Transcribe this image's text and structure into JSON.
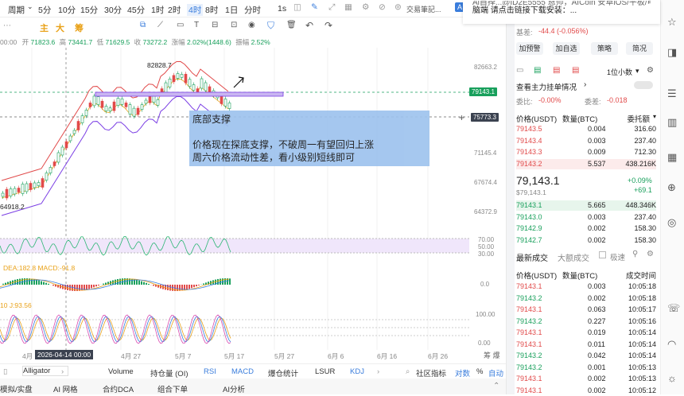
{
  "toolbar": {
    "period_label": "周期",
    "intervals": [
      "5分",
      "10分",
      "15分",
      "30分",
      "45分",
      "1时",
      "2时",
      "4时",
      "8时",
      "1日",
      "分时"
    ],
    "active_interval": "4时",
    "extra": "1s",
    "note_button": "交易筆記...",
    "ai_label": "A"
  },
  "toolbar2": {
    "items": [
      "主",
      "大",
      "筹"
    ]
  },
  "ohlc": {
    "time": "00:00",
    "open_label": "开",
    "open": "71823.6",
    "high_label": "高",
    "high": "73441.7",
    "low_label": "低",
    "low": "71629.5",
    "close_label": "收",
    "close": "73272.2",
    "change_label": "涨幅",
    "change": "2.02%(1448.6)",
    "amp_label": "振幅",
    "amp": "2.52%"
  },
  "chart": {
    "price_labels": [
      "82663.2",
      "79143.1",
      "75773.3",
      "71145.4",
      "67674.4",
      "64372.9"
    ],
    "high_marker": "82828.7",
    "low_marker": "64918.2",
    "rsi_labels": [
      "70.00",
      "50.00",
      "30.00"
    ],
    "macd_labels": [
      "0.0"
    ],
    "kdj_labels": [
      "100.00",
      "0.00"
    ],
    "macd_text": "DEA:182.8  MACD:-91.8",
    "kdj_text": "10  J:93.56",
    "dates": [
      "4月",
      "4月 27",
      "5月 7",
      "5月 17",
      "5月 27",
      "6月 6",
      "6月 16",
      "6月 26"
    ],
    "cursor_date": "2026-04-14 00:00",
    "side_chars": "筹 爆",
    "colors": {
      "up": "#19a05c",
      "down": "#e14a4a",
      "accent": "#3a7ddc",
      "annot_bg": "#9ec3ee"
    }
  },
  "annotation": {
    "title": "底部支撑",
    "line1": "价格现在探底支撑，不破周一有望回归上涨",
    "line2": "周六价格流动性差，看小级别短线即可"
  },
  "bottom_tabs": {
    "left": "Alligator",
    "items": [
      "Volume",
      "持仓量 (OI)",
      "RSI",
      "MACD",
      "爆仓统计",
      "LSUR",
      "KDJ"
    ],
    "community": "社区指标",
    "log": "对数",
    "pct": "%",
    "auto": "自动"
  },
  "footer": {
    "items": [
      "模拟/实盘",
      "AI 网格",
      "合约DCA",
      "组合下单",
      "AI分析"
    ]
  },
  "notice": {
    "line1": "Al自择...@ID2E5555 恩师，AICoin 安卓iOS/平板/电",
    "line2": "脑端 请点击链接下载安装：..."
  },
  "right": {
    "basis_label": "基差:",
    "basis": "-44.4 (-0.056%)",
    "buttons": [
      "加预警",
      "加自选",
      "策略",
      "简况"
    ],
    "depth_select": "1位小数",
    "big_orders": "查看主力挂单情况",
    "wei_bi_label": "委比:",
    "wei_bi": "-0.00%",
    "wei_cha_label": "委差:",
    "wei_cha": "-0.018",
    "ob_header": [
      "价格(USDT)",
      "数量(BTC)",
      "委托额"
    ],
    "asks": [
      [
        "79143.5",
        "0.004",
        "316.60"
      ],
      [
        "79143.4",
        "0.003",
        "237.40"
      ],
      [
        "79143.3",
        "0.009",
        "712.30"
      ],
      [
        "79143.2",
        "5.537",
        "438.216K"
      ]
    ],
    "last_price": "79,143.1",
    "last_price_sub": "$79,143.1",
    "change_pct": "+0.09%",
    "change_abs": "+69.1",
    "bids": [
      [
        "79143.1",
        "5.665",
        "448.346K"
      ],
      [
        "79143.0",
        "0.003",
        "237.40"
      ],
      [
        "79142.9",
        "0.002",
        "158.30"
      ],
      [
        "79142.7",
        "0.002",
        "158.30"
      ]
    ],
    "trades_tab": "最新成交",
    "big_trades_tab": "大额成交",
    "extreme": "极速",
    "trades_header": [
      "价格(USDT)",
      "数量(BTC)",
      "成交时间"
    ],
    "trades": [
      [
        "79143.1",
        "0.003",
        "10:05:18",
        "down"
      ],
      [
        "79143.2",
        "0.002",
        "10:05:18",
        "up"
      ],
      [
        "79143.1",
        "0.063",
        "10:05:17",
        "down"
      ],
      [
        "79143.2",
        "0.227",
        "10:05:16",
        "up"
      ],
      [
        "79143.1",
        "0.019",
        "10:05:14",
        "down"
      ],
      [
        "79143.1",
        "0.011",
        "10:05:14",
        "down"
      ],
      [
        "79143.2",
        "0.042",
        "10:05:14",
        "up"
      ],
      [
        "79143.2",
        "0.001",
        "10:05:13",
        "up"
      ],
      [
        "79143.1",
        "0.002",
        "10:05:13",
        "down"
      ],
      [
        "79143.1",
        "0.002",
        "10:05:12",
        "down"
      ]
    ]
  }
}
